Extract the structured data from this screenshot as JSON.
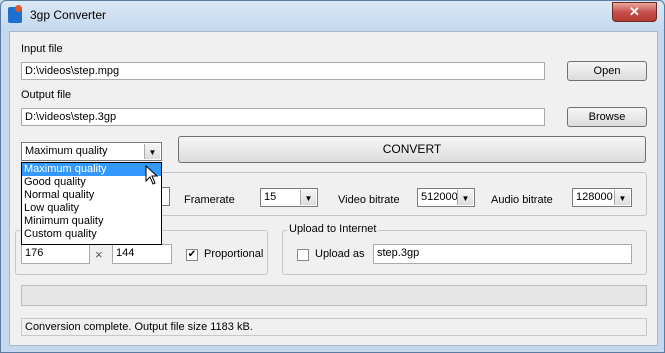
{
  "window": {
    "title": "3gp Converter",
    "close_glyph": "✕"
  },
  "input_file": {
    "label": "Input file",
    "value": "D:\\videos\\step.mpg",
    "button": "Open"
  },
  "output_file": {
    "label": "Output file",
    "value": "D:\\videos\\step.3gp",
    "button": "Browse"
  },
  "quality": {
    "selected": "Maximum quality",
    "options": [
      "Maximum quality",
      "Good quality",
      "Normal quality",
      "Low quality",
      "Minimum quality",
      "Custom quality"
    ]
  },
  "convert_button": "CONVERT",
  "settings": {
    "framerate_label": "Framerate",
    "framerate_value": "15",
    "video_bitrate_label": "Video bitrate",
    "video_bitrate_value": "512000",
    "audio_bitrate_label": "Audio bitrate",
    "audio_bitrate_value": "128000"
  },
  "size": {
    "width": "176",
    "times": "×",
    "height": "144",
    "proportional_label": "Proportional",
    "proportional_checked": true
  },
  "upload": {
    "group_label": "Upload to Internet",
    "upload_as_label": "Upload as",
    "upload_as_checked": false,
    "filename": "step.3gp"
  },
  "progress": {
    "fraction": 0
  },
  "status": "Conversion complete. Output file size 1183 kB.",
  "icons": {
    "dropdown_arrow": "▼",
    "check": "✔"
  }
}
